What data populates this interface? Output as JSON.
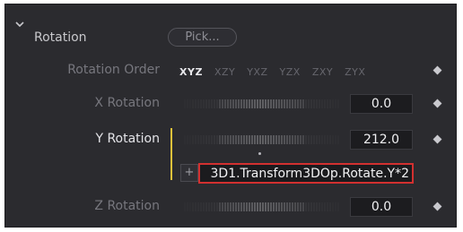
{
  "section": {
    "title": "Rotation",
    "pick_label": "Pick..."
  },
  "rotation_order": {
    "label": "Rotation Order",
    "options": [
      "XYZ",
      "XZY",
      "YXZ",
      "YZX",
      "ZXY",
      "ZYX"
    ],
    "selected": "XYZ"
  },
  "x_rotation": {
    "label": "X Rotation",
    "value": "0.0"
  },
  "y_rotation": {
    "label": "Y Rotation",
    "value": "212.0",
    "expression_plus": "+",
    "expression": "3D1.Transform3DOp.Rotate.Y*2"
  },
  "z_rotation": {
    "label": "Z Rotation",
    "value": "0.0"
  },
  "colors": {
    "panel_bg": "#2b2b2f",
    "active_label": "#e4e4e8",
    "inactive_label": "#77777e",
    "expression_border": "#d23030",
    "expression_indicator": "#e0c23a"
  },
  "icons": {
    "section_toggle": "chevron-down-icon",
    "keyframe": "diamond-icon"
  }
}
